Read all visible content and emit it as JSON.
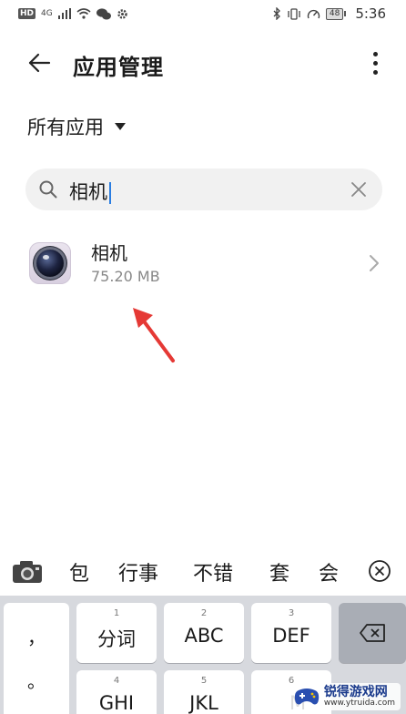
{
  "status_bar": {
    "left_badge": "HD",
    "network": "4G",
    "icons_left": [
      "signal-icon",
      "wifi-icon",
      "wechat-icon",
      "settings-gear-icon"
    ],
    "icons_right": [
      "bluetooth-icon",
      "vibrate-icon",
      "data-speed-icon",
      "battery-icon"
    ],
    "battery": "48",
    "time": "5:36"
  },
  "header": {
    "title": "应用管理",
    "back_icon": "back-arrow-icon",
    "more_icon": "more-vertical-icon"
  },
  "filter": {
    "label": "所有应用"
  },
  "search": {
    "value": "相机",
    "clear_icon": "clear-x-icon"
  },
  "app_list": [
    {
      "name": "相机",
      "size": "75.20 MB",
      "icon": "camera-app-icon"
    }
  ],
  "suggestions": {
    "items": [
      "包",
      "行事",
      "不错",
      "套",
      "会"
    ],
    "camera_icon": "camera-icon",
    "close_icon": "close-circle-icon"
  },
  "keyboard": {
    "left_column": [
      "，",
      "。"
    ],
    "row1": [
      {
        "num": "1",
        "label": "分词"
      },
      {
        "num": "2",
        "label": "ABC"
      },
      {
        "num": "3",
        "label": "DEF"
      }
    ],
    "row2": [
      {
        "num": "4",
        "label": "GHI"
      },
      {
        "num": "5",
        "label": "JKL"
      },
      {
        "num": "6",
        "label": "M"
      }
    ],
    "delete_icon": "backspace-icon"
  },
  "watermark": {
    "title": "锐得游戏网",
    "url": "www.ytruida.com"
  },
  "colors": {
    "accent_arrow": "#e53935",
    "caret": "#2a7de1",
    "keyboard_bg": "#d7d9de",
    "search_bg": "#f1f1f1"
  }
}
